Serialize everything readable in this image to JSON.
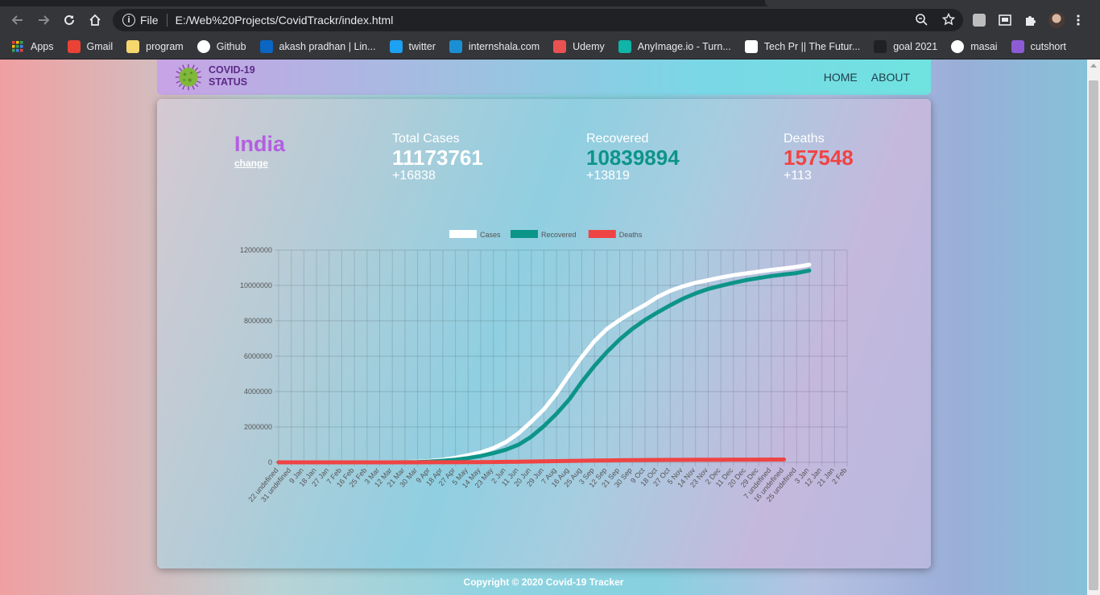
{
  "browser": {
    "url_protocol": "File",
    "url": "E:/Web%20Projects/CovidTrackr/index.html"
  },
  "bookmarks": [
    {
      "label": "Apps",
      "icon": "apps-grid-icon",
      "color": "#e8eaed"
    },
    {
      "label": "Gmail",
      "icon": "gmail-icon",
      "color": "#ea4335"
    },
    {
      "label": "program",
      "icon": "folder-icon",
      "color": "#f5d76e"
    },
    {
      "label": "Github",
      "icon": "github-icon",
      "color": "#ffffff"
    },
    {
      "label": "akash pradhan | Lin...",
      "icon": "linkedin-icon",
      "color": "#0a66c2"
    },
    {
      "label": "twitter",
      "icon": "twitter-icon",
      "color": "#1da1f2"
    },
    {
      "label": "internshala.com",
      "icon": "internshala-icon",
      "color": "#1a8fd3"
    },
    {
      "label": "Udemy",
      "icon": "udemy-icon",
      "color": "#ea5252"
    },
    {
      "label": "AnyImage.io - Turn...",
      "icon": "anyimage-icon",
      "color": "#0fb5a6"
    },
    {
      "label": "Tech Pr || The Futur...",
      "icon": "page-icon",
      "color": "#ffffff"
    },
    {
      "label": "goal 2021",
      "icon": "goal-icon",
      "color": "#202124"
    },
    {
      "label": "masai",
      "icon": "globe-icon",
      "color": "#ffffff"
    },
    {
      "label": "cutshort",
      "icon": "cutshort-icon",
      "color": "#8e5bd6"
    }
  ],
  "site": {
    "brand_line1": "COVID-19",
    "brand_line2": "STATUS",
    "nav_home": "HOME",
    "nav_about": "ABOUT",
    "footer": "Copyright © 2020 Covid-19 Tracker"
  },
  "summary": {
    "country": "India",
    "change": "change",
    "total_label": "Total Cases",
    "total_value": "11173761",
    "total_delta": "+16838",
    "recovered_label": "Recovered",
    "recovered_value": "10839894",
    "recovered_delta": "+13819",
    "deaths_label": "Deaths",
    "deaths_value": "157548",
    "deaths_delta": "+113"
  },
  "colors": {
    "cases": "#ffffff",
    "recovered": "#0d9488",
    "deaths": "#ef4444",
    "country": "#b35fe0"
  },
  "chart_data": {
    "type": "line",
    "categories": [
      "22 undefined",
      "31 undefined",
      "9 Jan",
      "18 Jan",
      "27 Jan",
      "7 Feb",
      "16 Feb",
      "25 Feb",
      "3 Mar",
      "12 Mar",
      "21 Mar",
      "30 Mar",
      "9 Apr",
      "18 Apr",
      "27 Apr",
      "5 May",
      "14 May",
      "23 May",
      "2 Jun",
      "11 Jun",
      "20 Jun",
      "29 Jun",
      "7 Aug",
      "16 Aug",
      "25 Aug",
      "3 Sep",
      "12 Sep",
      "21 Sep",
      "30 Sep",
      "9 Oct",
      "18 Oct",
      "27 Oct",
      "5 Nov",
      "14 Nov",
      "23 Nov",
      "2 Dec",
      "11 Dec",
      "20 Dec",
      "29 Dec",
      "7 undefined",
      "16 undefined",
      "25 undefined",
      "3 Jan",
      "12 Jan",
      "21 Jan",
      "2 Feb"
    ],
    "series": [
      {
        "name": "Cases",
        "values": [
          0,
          0,
          0,
          0,
          0,
          0,
          0,
          0,
          3000,
          9000,
          20000,
          40000,
          80000,
          150000,
          260000,
          400000,
          560000,
          800000,
          1150000,
          1650000,
          2300000,
          3000000,
          3900000,
          4950000,
          5950000,
          6850000,
          7550000,
          8050000,
          8500000,
          8900000,
          9350000,
          9700000,
          9950000,
          10150000,
          10300000,
          10450000,
          10580000,
          10680000,
          10780000,
          10880000,
          10960000,
          11050000,
          11173761
        ]
      },
      {
        "name": "Recovered",
        "values": [
          0,
          0,
          0,
          0,
          0,
          0,
          0,
          0,
          1000,
          4000,
          10000,
          20000,
          45000,
          90000,
          150000,
          240000,
          360000,
          520000,
          720000,
          1000000,
          1450000,
          2050000,
          2750000,
          3550000,
          4550000,
          5450000,
          6250000,
          6950000,
          7550000,
          8050000,
          8480000,
          8880000,
          9250000,
          9550000,
          9800000,
          9980000,
          10150000,
          10300000,
          10420000,
          10530000,
          10620000,
          10700000,
          10839894
        ]
      },
      {
        "name": "Deaths",
        "values": [
          0,
          0,
          0,
          0,
          0,
          0,
          0,
          0,
          100,
          300,
          800,
          1500,
          2500,
          4000,
          6000,
          9000,
          13000,
          18000,
          26000,
          35000,
          45000,
          56000,
          67000,
          79000,
          90000,
          100000,
          109000,
          117000,
          124000,
          130000,
          135000,
          139000,
          143000,
          146000,
          149000,
          151000,
          153000,
          155000,
          156000,
          157000,
          157548
        ]
      }
    ],
    "ylim": [
      0,
      12000000
    ],
    "yticks": [
      0,
      2000000,
      4000000,
      6000000,
      8000000,
      10000000,
      12000000
    ],
    "legend": "top-center",
    "grid": true
  }
}
